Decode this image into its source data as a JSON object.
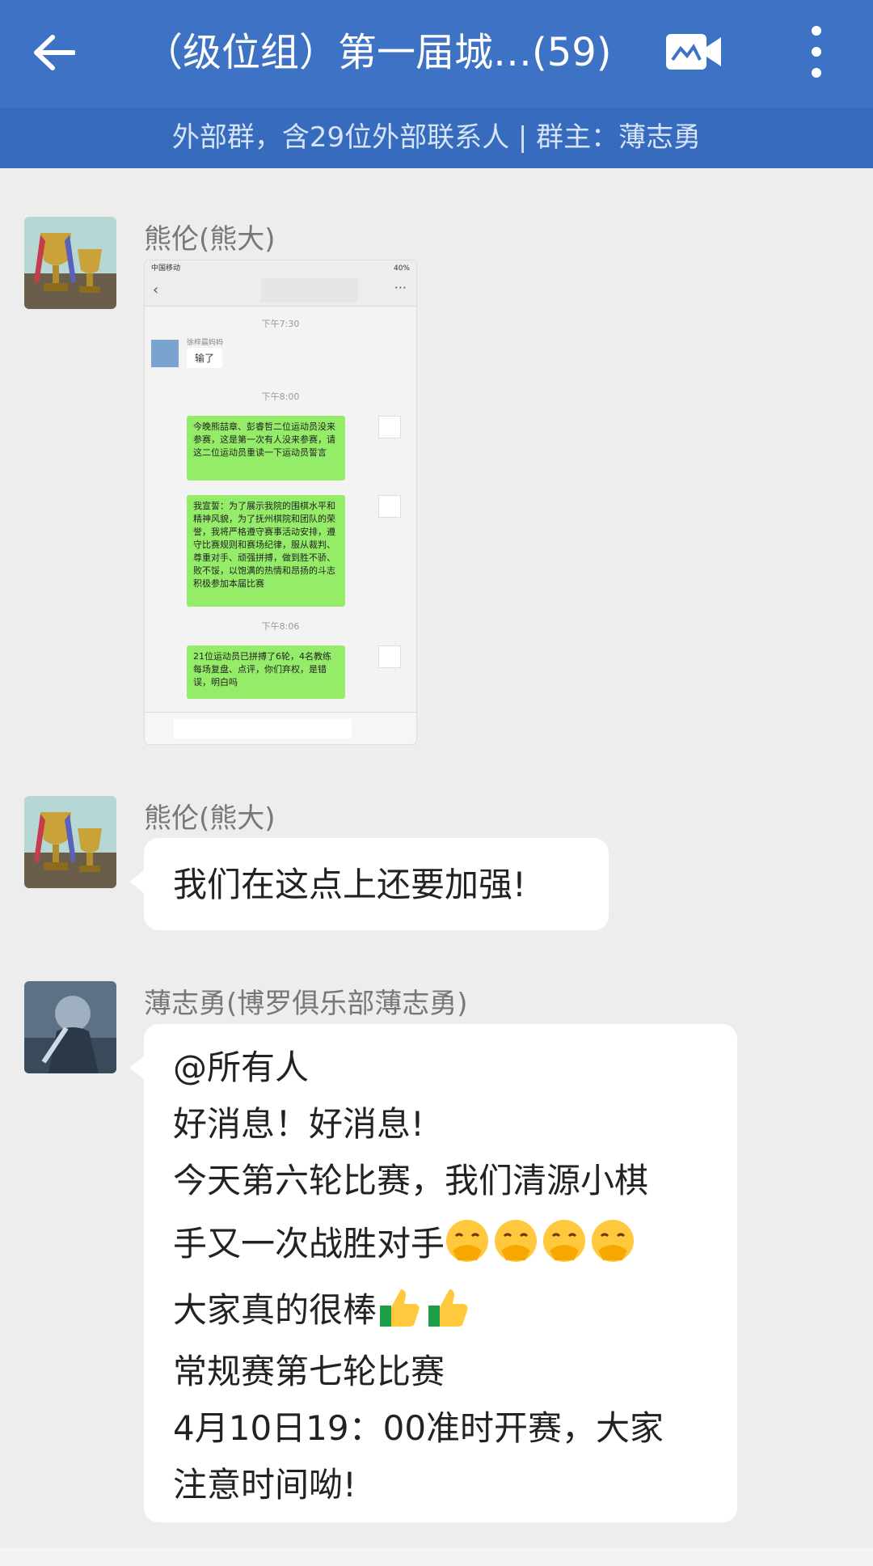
{
  "header": {
    "title": "（级位组）第一届城…(59)",
    "subtitle": "外部群，含29位外部联系人 | 群主：薄志勇",
    "icons": [
      "back-arrow-icon",
      "video-call-icon",
      "more-vertical-icon"
    ]
  },
  "messages": [
    {
      "sender": "熊伦(熊大)",
      "type": "image",
      "screenshot": {
        "carrier": "中国移动",
        "battery": "40%",
        "items": [
          {
            "time": "下午7:30"
          },
          {
            "name": "徐梓晨妈妈",
            "text": "输了"
          },
          {
            "time": "下午8:00"
          },
          {
            "text": "今晚熊喆章、彭睿哲二位运动员没来参赛，这是第一次有人没来参赛，请这二位运动员重读一下运动员誓言"
          },
          {
            "text": "我宣誓：为了展示我院的围棋水平和精神风貌，为了抚州棋院和团队的荣誉，我将严格遵守赛事活动安排，遵守比赛规则和赛场纪律，服从裁判、尊重对手、顽强拼搏，做到胜不骄、败不馁，以饱满的热情和昂扬的斗志积极参加本届比赛"
          },
          {
            "time": "下午8:06"
          },
          {
            "text": "21位运动员已拼搏了6轮，4名教练每场复盘、点评，你们弃权，是错误，明白吗"
          }
        ]
      }
    },
    {
      "sender": "熊伦(熊大)",
      "type": "text",
      "text": "我们在这点上还要加强!"
    },
    {
      "sender": "薄志勇(博罗俱乐部薄志勇)",
      "type": "text",
      "lines": [
        "@所有人",
        "好消息！好消息!",
        "今天第六轮比赛，我们清源小棋",
        "手又一次战胜对手",
        "大家真的很棒",
        "常规赛第七轮比赛",
        "4月10日19：00准时开赛，大家",
        "注意时间呦!"
      ],
      "emoji": {
        "line4": "hand-over-mouth-emoji",
        "line4_count": 4,
        "line5": "thumbs-up-emoji",
        "line5_count": 2
      }
    }
  ],
  "colors": {
    "header": "#3d72c4",
    "subheader": "#366bbd",
    "background": "#ededed",
    "bubble": "#ffffff",
    "wechat_green": "#95ec69"
  }
}
